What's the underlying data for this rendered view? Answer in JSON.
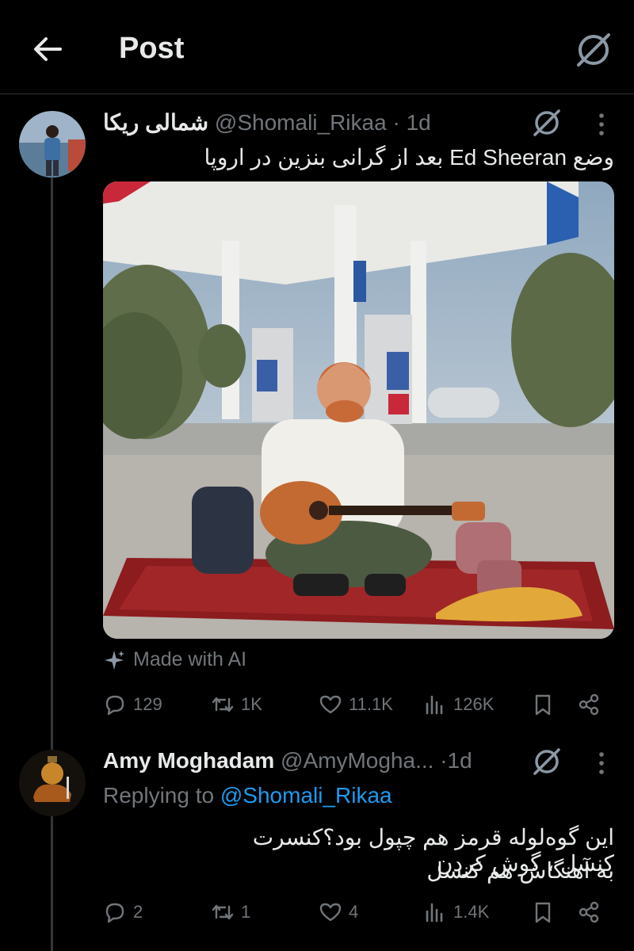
{
  "header": {
    "title": "Post"
  },
  "tweet": {
    "display_name": "شمالی ریکا",
    "handle": "@Shomali_Rikaa",
    "separator": "·",
    "time": "1d",
    "text": "وضع Ed Sheeran بعد از گرانی بنزین در اروپا",
    "ai_label": "Made with AI",
    "stats": {
      "replies": "129",
      "reposts": "1K",
      "likes": "11.1K",
      "views": "126K"
    }
  },
  "reply": {
    "display_name": "Amy Moghadam",
    "handle": "@AmyMogha...",
    "separator": "·",
    "time": "1d",
    "replying_prefix": "Replying to",
    "replying_to": "@Shomali_Rikaa",
    "text_line1": "این گوه‌لوله قرمز هم چپول بود؟کنسرت کنسل ، گوش کردن",
    "text_line2": "به آهنگاش هم کنسل",
    "stats": {
      "replies": "2",
      "reposts": "1",
      "likes": "4",
      "views": "1.4K"
    }
  },
  "colors": {
    "background": "#000000",
    "text": "#e7e9ea",
    "muted": "#71767b",
    "link": "#1d9bf0",
    "divider": "#2f3336"
  },
  "icons": [
    "back-arrow-icon",
    "grok-icon",
    "more-icon",
    "sparkle-icon",
    "reply-icon",
    "repost-icon",
    "like-icon",
    "views-icon",
    "bookmark-icon",
    "share-icon"
  ]
}
